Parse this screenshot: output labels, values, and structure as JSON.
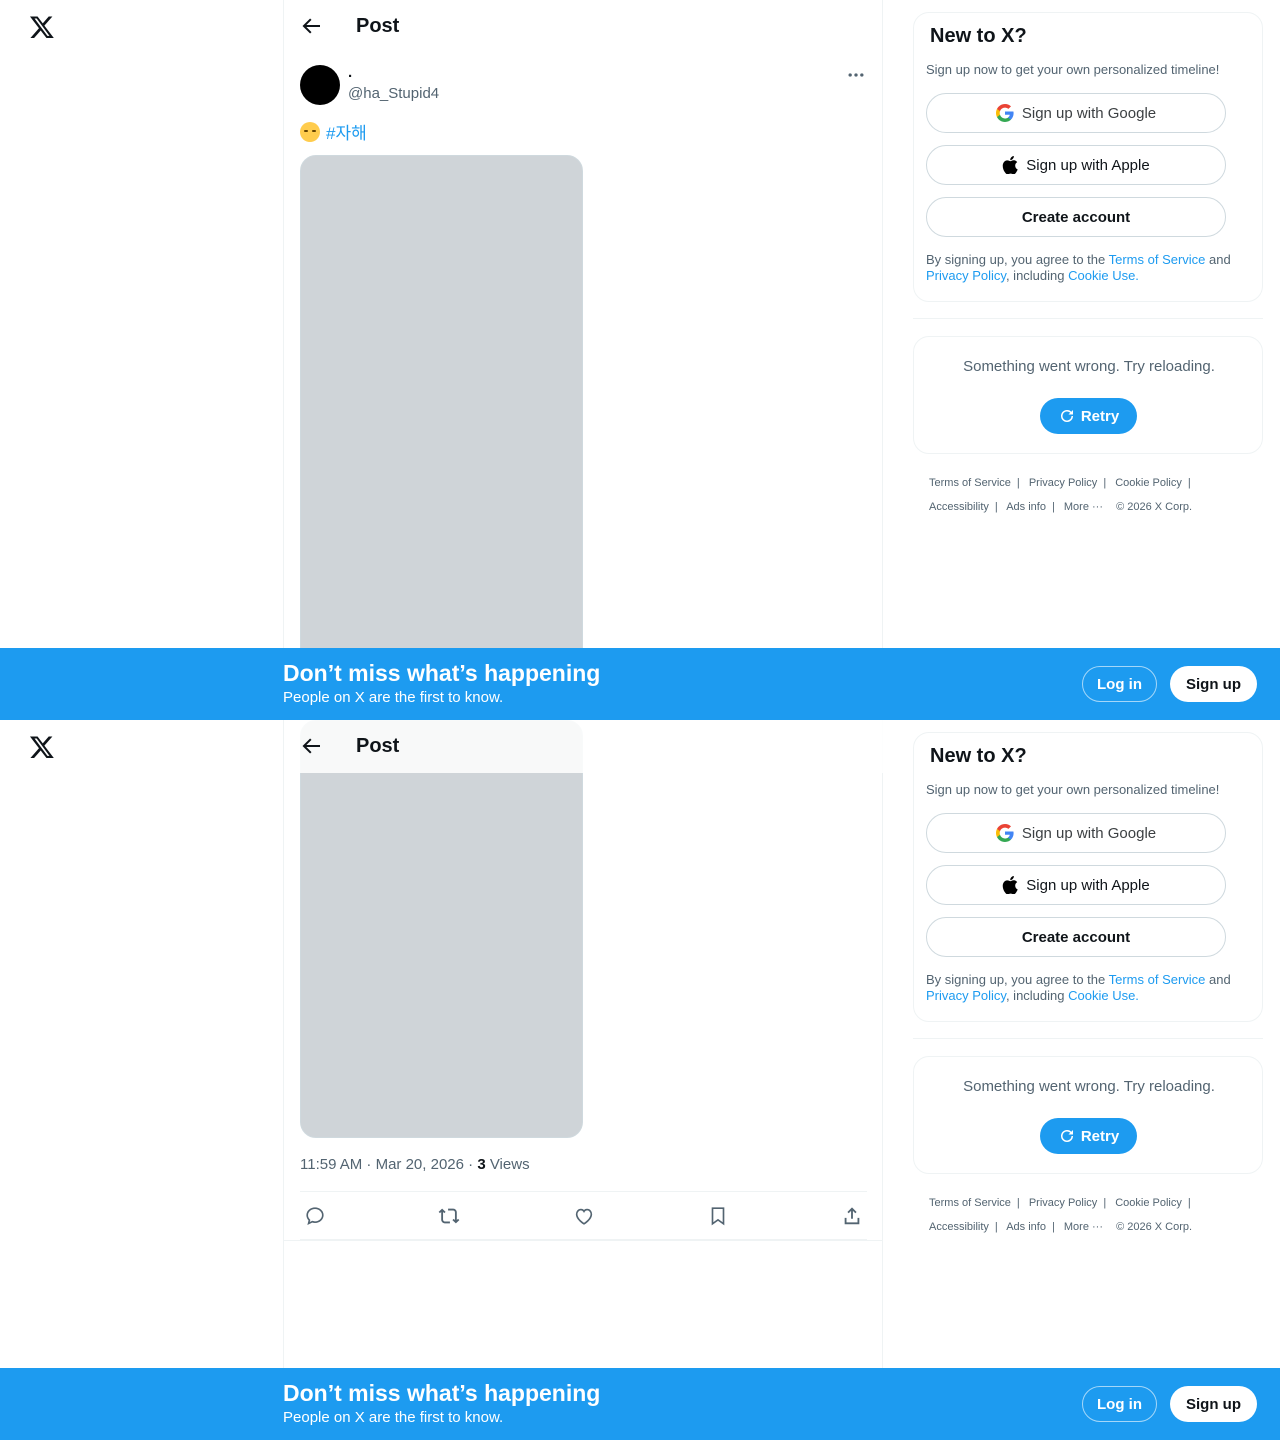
{
  "header": {
    "title": "Post"
  },
  "post": {
    "display_name": ".",
    "handle": "@ha_Stupid4",
    "emoji": "downcast-face-with-sweat",
    "hashtag": "#자해",
    "time": "11:59 AM · Mar 20, 2026 · ",
    "views_count": "3",
    "views_label": " Views"
  },
  "signup": {
    "title": "New to X?",
    "subtitle": "Sign up now to get your own personalized timeline!",
    "google_label": "Sign up with Google",
    "apple_label": "Sign up with Apple",
    "create_label": "Create account",
    "terms_prefix": "By signing up, you agree to the ",
    "terms_link": "Terms of Service",
    "terms_and": " and ",
    "privacy_link": "Privacy Policy",
    "terms_including": ", including ",
    "cookie_link": "Cookie Use."
  },
  "error": {
    "message": "Something went wrong. Try reloading.",
    "retry_label": "Retry"
  },
  "footer": {
    "links": [
      "Terms of Service",
      "Privacy Policy",
      "Cookie Policy",
      "Accessibility",
      "Ads info",
      "More ···"
    ],
    "copyright": "© 2026 X Corp."
  },
  "banner": {
    "title": "Don’t miss what’s happening",
    "subtitle": "People on X are the first to know.",
    "login_label": "Log in",
    "signup_label": "Sign up"
  },
  "colors": {
    "accent": "#1d9bf0",
    "text": "#0f1419",
    "muted": "#536471",
    "border": "#eff3f4"
  }
}
